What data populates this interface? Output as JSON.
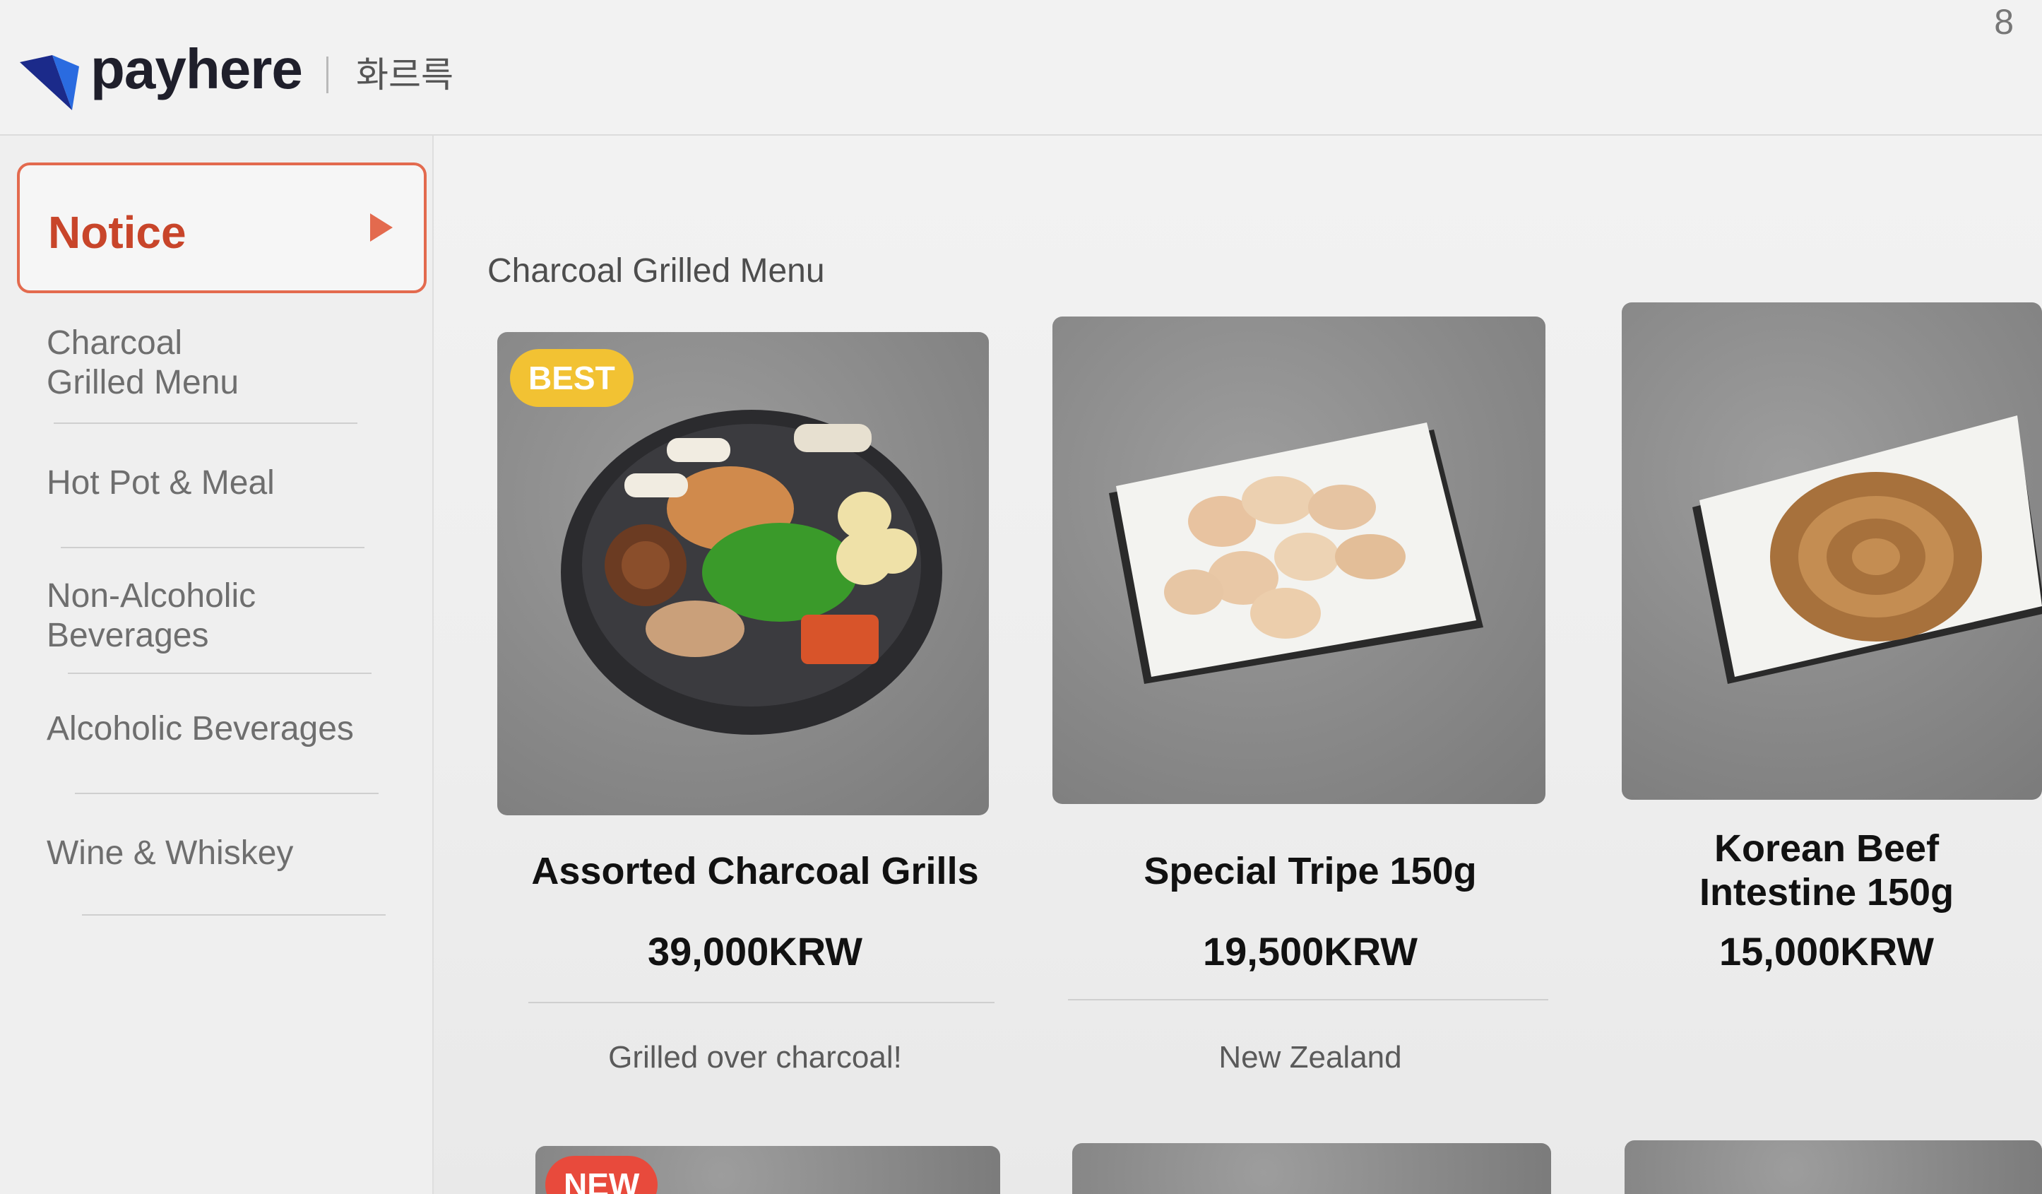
{
  "header": {
    "brand": "payhere",
    "store_name": "화르륵",
    "corner_number": "8"
  },
  "colors": {
    "accent": "#e36a4e",
    "notice_text": "#c8452a",
    "best_badge": "#f2c233",
    "new_badge": "#e84a3c",
    "logo_blue": "#2a6be0",
    "logo_dark": "#1b2a8a"
  },
  "sidebar": {
    "notice": {
      "label": "Notice",
      "icon": "play-arrow-icon"
    },
    "items": [
      {
        "label": "Charcoal\nGrilled Menu"
      },
      {
        "label": "Hot Pot & Meal"
      },
      {
        "label": "Non-Alcoholic\nBeverages"
      },
      {
        "label": "Alcoholic Beverages"
      },
      {
        "label": "Wine & Whiskey"
      }
    ]
  },
  "main": {
    "section_title": "Charcoal Grilled Menu",
    "products": [
      {
        "badge": "BEST",
        "name": "Assorted Charcoal Grills",
        "price": "39,000KRW",
        "description": "Grilled over charcoal!"
      },
      {
        "name": "Special Tripe 150g",
        "price": "19,500KRW",
        "description": "New Zealand"
      },
      {
        "name": "Korean Beef\nIntestine 150g",
        "price": "15,000KRW"
      }
    ],
    "next_row": [
      {
        "badge": "NEW"
      },
      {},
      {}
    ]
  }
}
